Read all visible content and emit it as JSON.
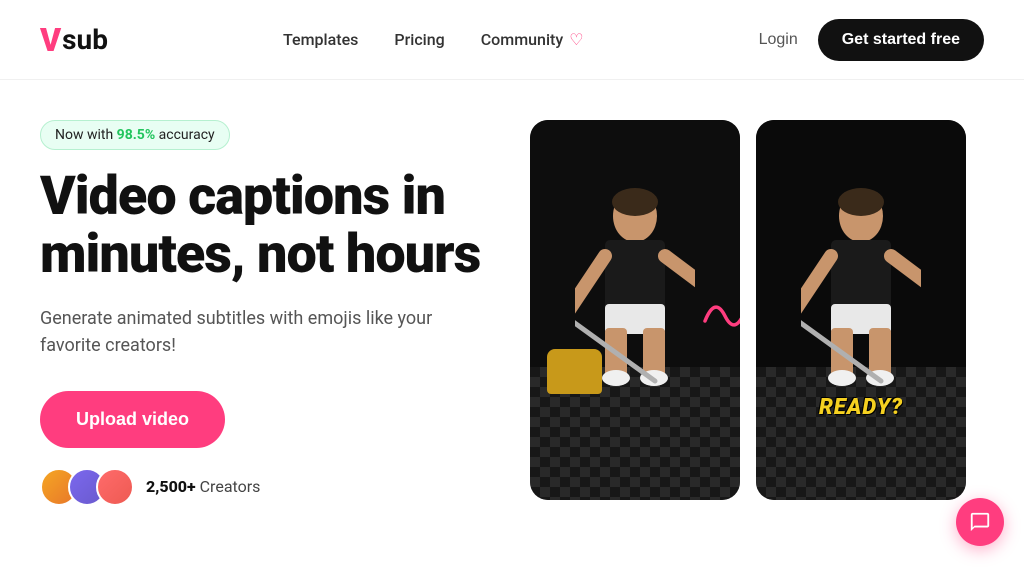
{
  "brand": {
    "logo_letter": "V",
    "logo_text": "sub"
  },
  "nav": {
    "links": [
      {
        "id": "templates",
        "label": "Templates"
      },
      {
        "id": "pricing",
        "label": "Pricing"
      },
      {
        "id": "community",
        "label": "Community",
        "has_heart": true
      }
    ],
    "login_label": "Login",
    "cta_label": "Get started free"
  },
  "hero": {
    "badge_prefix": "Now with ",
    "badge_highlight": "98.5%",
    "badge_suffix": " accuracy",
    "title": "Video captions in minutes, not hours",
    "subtitle": "Generate animated subtitles with emojis like your favorite creators!",
    "upload_btn": "Upload video",
    "creators_count": "2,500+",
    "creators_label": " Creators"
  },
  "video1": {
    "caption": ""
  },
  "video2": {
    "caption": "READY?"
  },
  "chat": {
    "icon": "💬"
  }
}
